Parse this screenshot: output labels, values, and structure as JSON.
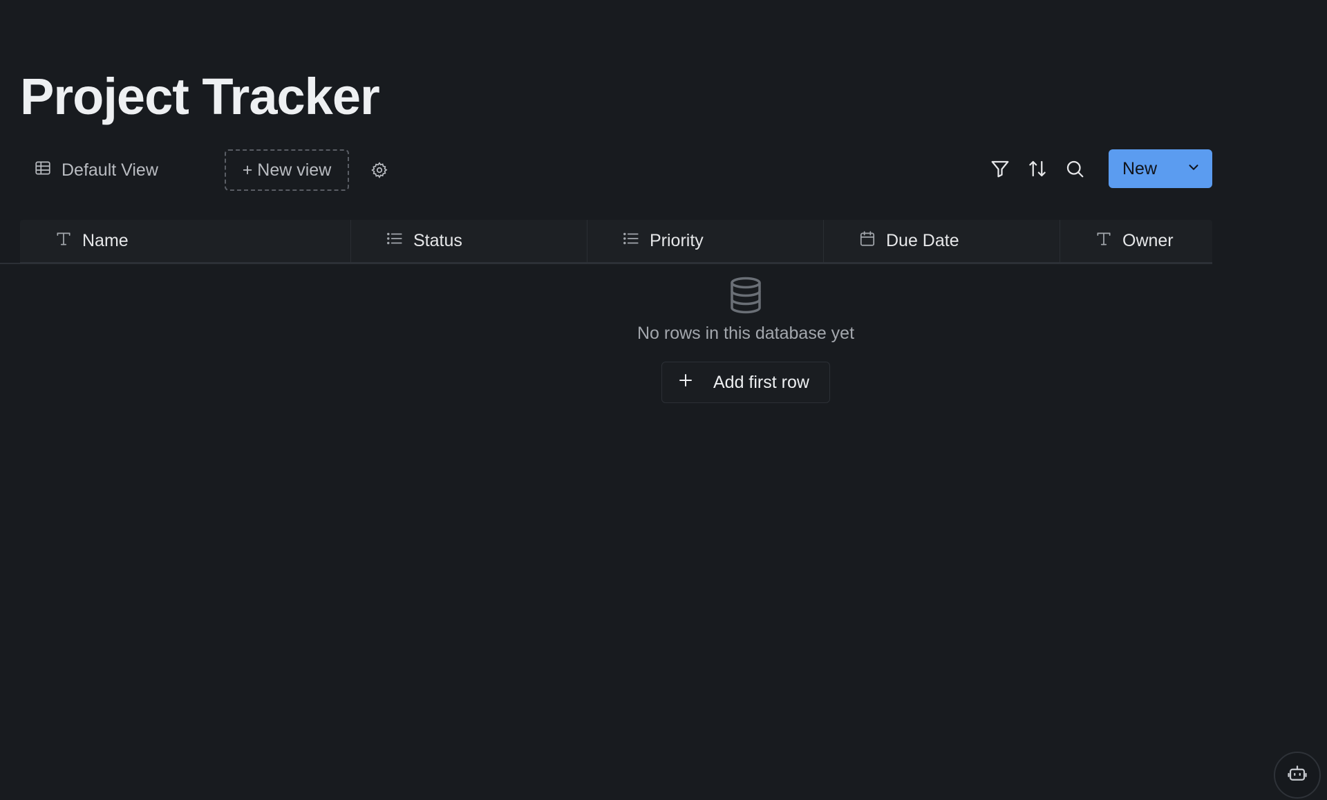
{
  "page": {
    "title": "Project Tracker"
  },
  "viewbar": {
    "current_view": "Default View",
    "new_view_label": "+ New view",
    "icons": [
      "table-icon",
      "gear-icon",
      "filter-icon",
      "sort-icon",
      "search-icon",
      "chevron-down-icon"
    ]
  },
  "toolbar": {
    "new_label": "New"
  },
  "table": {
    "columns": [
      {
        "label": "Name",
        "icon": "text-type-icon"
      },
      {
        "label": "Status",
        "icon": "list-icon"
      },
      {
        "label": "Priority",
        "icon": "list-icon"
      },
      {
        "label": "Due Date",
        "icon": "calendar-icon"
      },
      {
        "label": "Owner",
        "icon": "text-type-icon"
      }
    ],
    "rows": []
  },
  "empty_state": {
    "icon": "database-icon",
    "message": "No rows in this database yet",
    "add_label": "Add first row"
  },
  "assistant": {
    "icon": "robot-icon"
  },
  "colors": {
    "background": "#181b1f",
    "accent": "#5b9cf0",
    "header_bg": "#1d2024",
    "muted_text": "#a3a7ad"
  }
}
